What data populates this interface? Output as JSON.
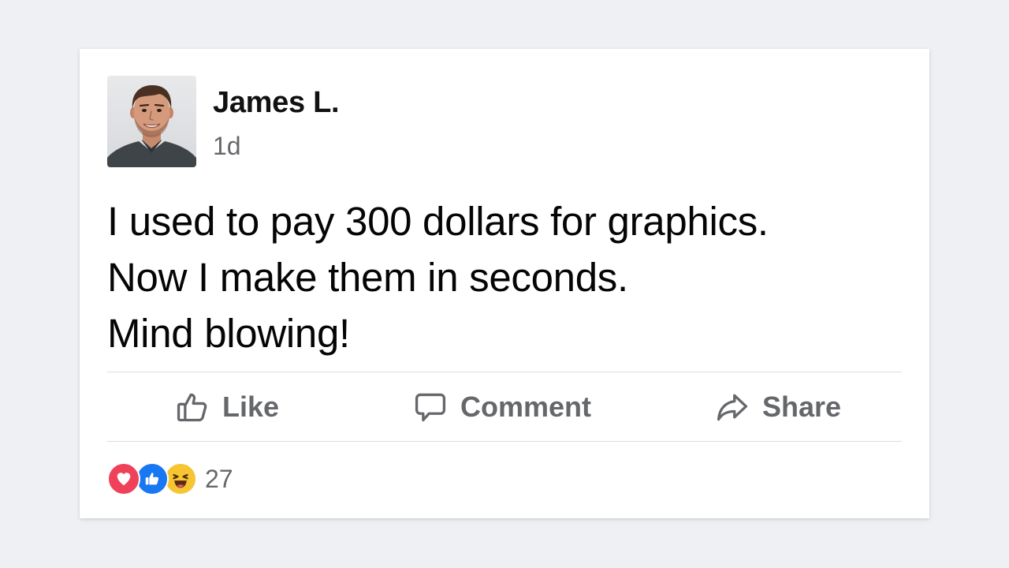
{
  "post": {
    "author": "James L.",
    "time": "1d",
    "lines": [
      "I used to pay 300 dollars for graphics.",
      "Now I make them in seconds.",
      "Mind blowing!"
    ]
  },
  "actions": {
    "like": "Like",
    "comment": "Comment",
    "share": "Share"
  },
  "reactions": {
    "icons": [
      "heart-icon",
      "thumbs-up-icon",
      "laughing-face-icon"
    ],
    "count": "27"
  },
  "colors": {
    "background": "#eef0f3",
    "card": "#ffffff",
    "secondary_text": "#65676b",
    "love": "#f0415a",
    "like": "#1877f2",
    "haha": "#f7c531"
  }
}
